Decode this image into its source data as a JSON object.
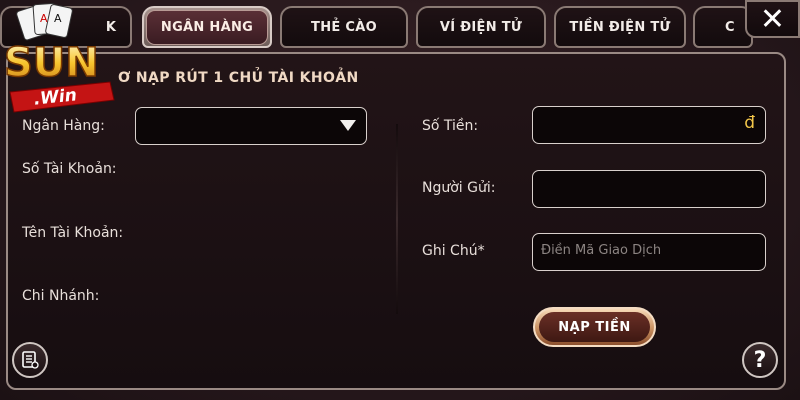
{
  "tabs": [
    {
      "label": "K",
      "active": false
    },
    {
      "label": "NGÂN HÀNG",
      "active": true
    },
    {
      "label": "THẺ CÀO",
      "active": false
    },
    {
      "label": "VÍ ĐIỆN TỬ",
      "active": false
    },
    {
      "label": "TIỀN ĐIỆN TỬ",
      "active": false
    },
    {
      "label": "C",
      "active": false
    }
  ],
  "close_label": "✕",
  "logo": {
    "main": "SUN",
    "sub": ".Win"
  },
  "subtitle": "Ơ NẠP RÚT 1 CHỦ TÀI KHOẢN",
  "left_form": {
    "bank_label": "Ngân Hàng:",
    "account_number_label": "Số Tài Khoản:",
    "account_name_label": "Tên Tài Khoản:",
    "branch_label": "Chi Nhánh:"
  },
  "right_form": {
    "amount_label": "Số Tiền:",
    "currency_symbol": "đ",
    "sender_label": "Người Gửi:",
    "note_label": "Ghi Chú*",
    "note_placeholder": "Điền Mã Giao Dịch"
  },
  "deposit_button": "NẠP TIỀN",
  "help_label": "?",
  "colors": {
    "accent_gold": "#f3c64a",
    "tab_active": "#5a2f36",
    "button_brown": "#6a2f26"
  }
}
